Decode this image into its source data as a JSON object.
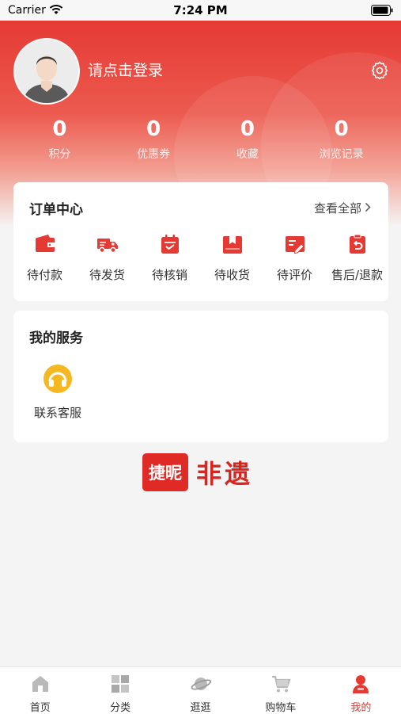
{
  "status_bar": {
    "carrier": "Carrier",
    "time": "7:24 PM"
  },
  "header": {
    "login_text": "请点击登录"
  },
  "stats": [
    {
      "value": "0",
      "label": "积分"
    },
    {
      "value": "0",
      "label": "优惠券"
    },
    {
      "value": "0",
      "label": "收藏"
    },
    {
      "value": "0",
      "label": "浏览记录"
    }
  ],
  "order_center": {
    "title": "订单中心",
    "view_all": "查看全部",
    "items": [
      {
        "label": "待付款",
        "icon": "wallet-icon"
      },
      {
        "label": "待发货",
        "icon": "truck-icon"
      },
      {
        "label": "待核销",
        "icon": "calendar-check-icon"
      },
      {
        "label": "待收货",
        "icon": "package-icon"
      },
      {
        "label": "待评价",
        "icon": "review-icon"
      },
      {
        "label": "售后/退款",
        "icon": "refund-icon"
      }
    ]
  },
  "services": {
    "title": "我的服务",
    "items": [
      {
        "label": "联系客服",
        "icon": "headset-icon"
      }
    ]
  },
  "brand": {
    "logo_text": "捷昵",
    "name": "非遗"
  },
  "tabs": [
    {
      "label": "首页",
      "icon": "home-icon",
      "active": false
    },
    {
      "label": "分类",
      "icon": "category-icon",
      "active": false
    },
    {
      "label": "逛逛",
      "icon": "planet-icon",
      "active": false
    },
    {
      "label": "购物车",
      "icon": "cart-icon",
      "active": false
    },
    {
      "label": "我的",
      "icon": "profile-icon",
      "active": true
    }
  ],
  "colors": {
    "primary": "#e53a34",
    "background": "#f4f4f4",
    "card": "#ffffff",
    "service_icon": "#f5b820"
  }
}
